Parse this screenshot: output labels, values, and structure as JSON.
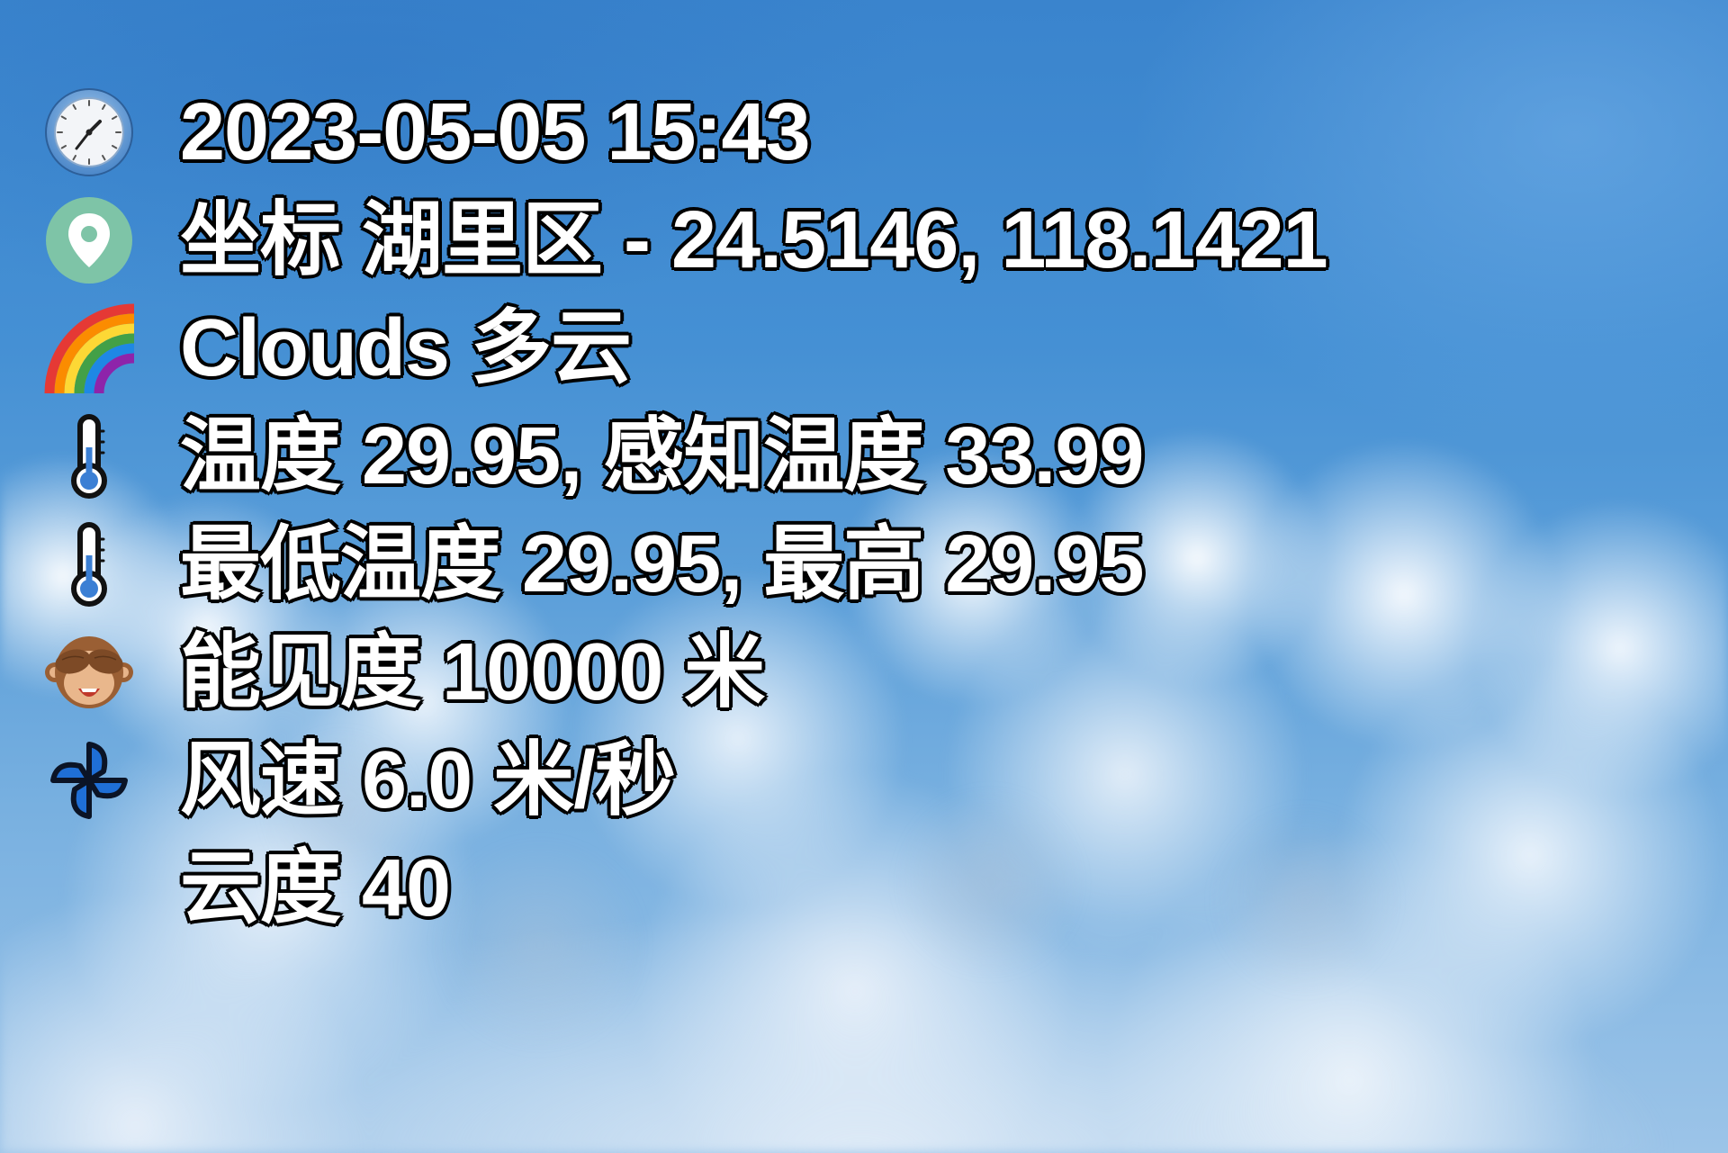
{
  "rows": [
    {
      "icon": "clock-icon",
      "text": "2023-05-05 15:43"
    },
    {
      "icon": "location-pin-icon",
      "text": "坐标 湖里区 - 24.5146, 118.1421"
    },
    {
      "icon": "rainbow-icon",
      "text": "Clouds 多云"
    },
    {
      "icon": "thermometer-icon",
      "text": "温度 29.95, 感知温度 33.99"
    },
    {
      "icon": "thermometer-icon",
      "text": "最低温度 29.95, 最高 29.95"
    },
    {
      "icon": "see-no-evil-monkey-icon",
      "text": "能见度 10000 米"
    },
    {
      "icon": "pinwheel-icon",
      "text": "风速 6.0 米/秒"
    },
    {
      "icon": "",
      "text": "云度 40"
    }
  ],
  "colors": {
    "text": "#ffffff",
    "text_outline": "#000000",
    "sky": "#3a84cd",
    "cloud": "#ffffff"
  }
}
